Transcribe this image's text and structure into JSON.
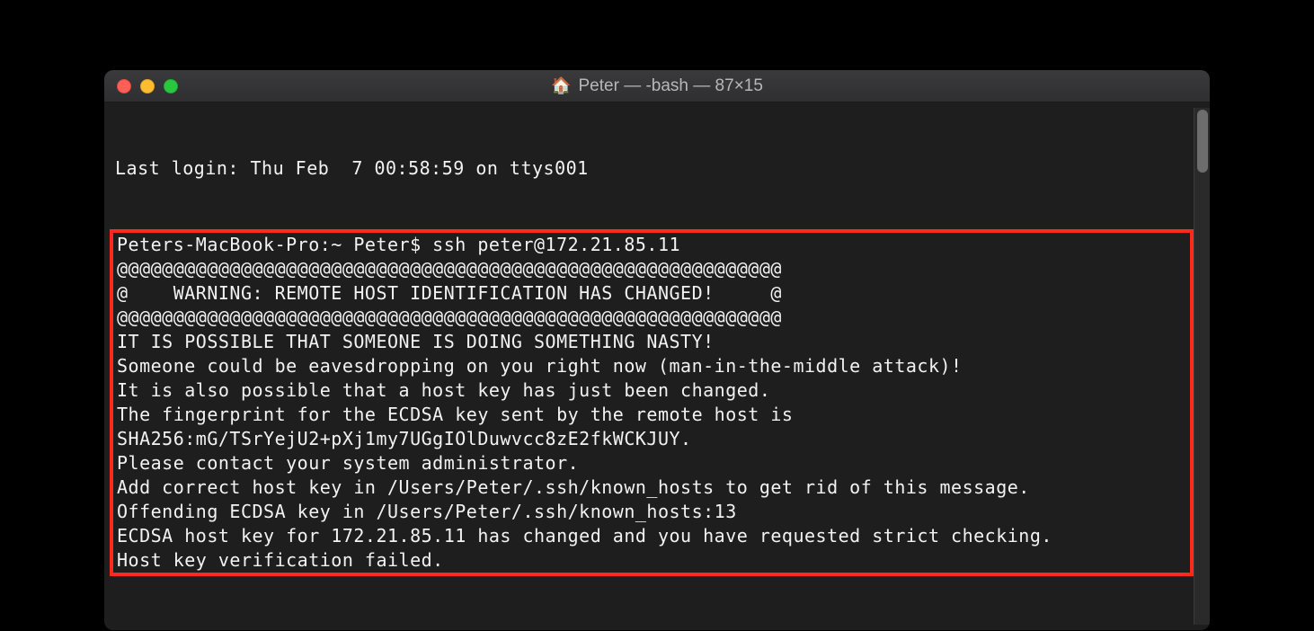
{
  "window": {
    "title": "Peter — -bash — 87×15",
    "icon": "🏠"
  },
  "terminal": {
    "preLines": [
      "Last login: Thu Feb  7 00:58:59 on ttys001"
    ],
    "boxLines": [
      "Peters-MacBook-Pro:~ Peter$ ssh peter@172.21.85.11",
      "@@@@@@@@@@@@@@@@@@@@@@@@@@@@@@@@@@@@@@@@@@@@@@@@@@@@@@@@@@@",
      "@    WARNING: REMOTE HOST IDENTIFICATION HAS CHANGED!     @",
      "@@@@@@@@@@@@@@@@@@@@@@@@@@@@@@@@@@@@@@@@@@@@@@@@@@@@@@@@@@@",
      "IT IS POSSIBLE THAT SOMEONE IS DOING SOMETHING NASTY!",
      "Someone could be eavesdropping on you right now (man-in-the-middle attack)!",
      "It is also possible that a host key has just been changed.",
      "The fingerprint for the ECDSA key sent by the remote host is",
      "SHA256:mG/TSrYejU2+pXj1my7UGgIOlDuwvcc8zE2fkWCKJUY.",
      "Please contact your system administrator.",
      "Add correct host key in /Users/Peter/.ssh/known_hosts to get rid of this message.",
      "Offending ECDSA key in /Users/Peter/.ssh/known_hosts:13",
      "ECDSA host key for 172.21.85.11 has changed and you have requested strict checking.",
      "Host key verification failed."
    ]
  }
}
